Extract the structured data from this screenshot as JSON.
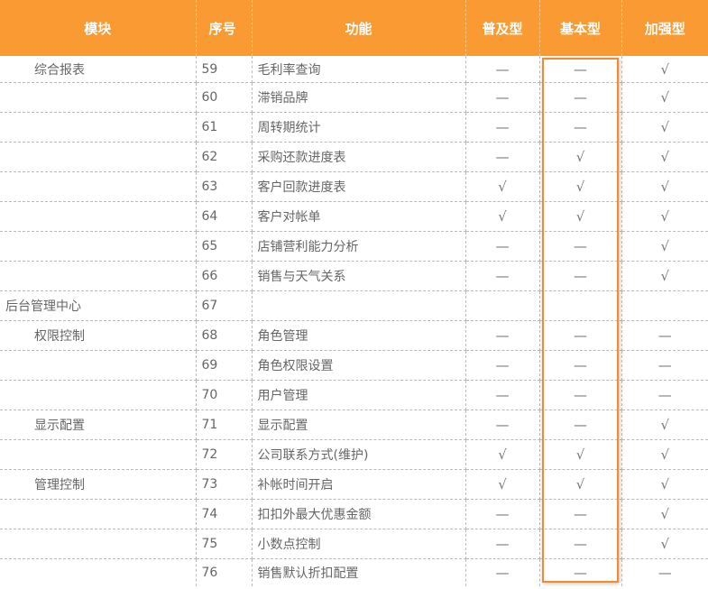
{
  "header": {
    "module": "模块",
    "number": "序号",
    "function": "功能",
    "basic_popular": "普及型",
    "basic": "基本型",
    "enhanced": "加强型"
  },
  "symbols": {
    "yes": "√",
    "no": "—"
  },
  "rows": [
    {
      "module": "综合报表",
      "level": 1,
      "number": "59",
      "function": "毛利率查询",
      "marks": [
        "—",
        "—",
        "√"
      ]
    },
    {
      "module": "",
      "level": 1,
      "number": "60",
      "function": "滞销品牌",
      "marks": [
        "—",
        "—",
        "√"
      ]
    },
    {
      "module": "",
      "level": 1,
      "number": "61",
      "function": "周转期统计",
      "marks": [
        "—",
        "—",
        "√"
      ]
    },
    {
      "module": "",
      "level": 1,
      "number": "62",
      "function": "采购还款进度表",
      "marks": [
        "—",
        "√",
        "√"
      ]
    },
    {
      "module": "",
      "level": 1,
      "number": "63",
      "function": "客户回款进度表",
      "marks": [
        "√",
        "√",
        "√"
      ]
    },
    {
      "module": "",
      "level": 1,
      "number": "64",
      "function": "客户对帐单",
      "marks": [
        "√",
        "√",
        "√"
      ]
    },
    {
      "module": "",
      "level": 1,
      "number": "65",
      "function": "店铺营利能力分析",
      "marks": [
        "—",
        "—",
        "√"
      ]
    },
    {
      "module": "",
      "level": 1,
      "number": "66",
      "function": "销售与天气关系",
      "marks": [
        "—",
        "—",
        "√"
      ]
    },
    {
      "module": "后台管理中心",
      "level": 0,
      "number": "67",
      "function": "",
      "marks": [
        "",
        "",
        ""
      ]
    },
    {
      "module": "权限控制",
      "level": 1,
      "number": "68",
      "function": "角色管理",
      "marks": [
        "—",
        "—",
        "—"
      ]
    },
    {
      "module": "",
      "level": 1,
      "number": "69",
      "function": "角色权限设置",
      "marks": [
        "—",
        "—",
        "—"
      ]
    },
    {
      "module": "",
      "level": 1,
      "number": "70",
      "function": "用户管理",
      "marks": [
        "—",
        "—",
        "—"
      ]
    },
    {
      "module": "显示配置",
      "level": 1,
      "number": "71",
      "function": "显示配置",
      "marks": [
        "—",
        "—",
        "√"
      ]
    },
    {
      "module": "",
      "level": 1,
      "number": "72",
      "function": "公司联系方式(维护)",
      "marks": [
        "√",
        "√",
        "√"
      ]
    },
    {
      "module": "管理控制",
      "level": 1,
      "number": "73",
      "function": "补帐时间开启",
      "marks": [
        "√",
        "√",
        "√"
      ]
    },
    {
      "module": "",
      "level": 1,
      "number": "74",
      "function": "扣扣外最大优惠金额",
      "marks": [
        "—",
        "—",
        "√"
      ]
    },
    {
      "module": "",
      "level": 1,
      "number": "75",
      "function": "小数点控制",
      "marks": [
        "—",
        "—",
        "√"
      ]
    },
    {
      "module": "",
      "level": 1,
      "number": "76",
      "function": "销售默认折扣配置",
      "marks": [
        "—",
        "—",
        "—"
      ]
    }
  ]
}
